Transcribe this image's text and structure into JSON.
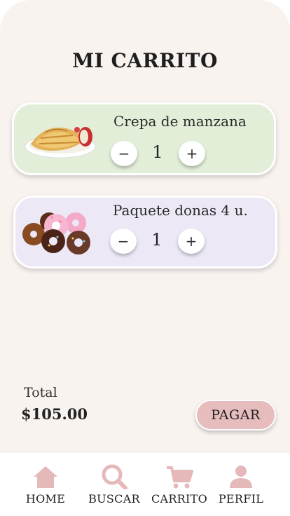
{
  "header": {
    "title": "MI CARRITO"
  },
  "cart": {
    "items": [
      {
        "name": "Crepa de manzana",
        "quantity": "1",
        "image_icon": "crepe-image",
        "card_color": "#e2eed8"
      },
      {
        "name": "Paquete donas 4 u.",
        "quantity": "1",
        "image_icon": "donuts-image",
        "card_color": "#ece8f6"
      }
    ],
    "minus_symbol": "−",
    "plus_symbol": "+"
  },
  "summary": {
    "total_label": "Total",
    "total_amount": "$105.00",
    "pay_label": "PAGAR"
  },
  "nav": {
    "items": [
      {
        "label": "HOME",
        "icon": "home-icon"
      },
      {
        "label": "BUSCAR",
        "icon": "search-icon"
      },
      {
        "label": "CARRITO",
        "icon": "cart-icon"
      },
      {
        "label": "PERFIL",
        "icon": "user-icon"
      }
    ]
  },
  "colors": {
    "background": "#f9f3f0",
    "accent": "#e6bcbc",
    "nav_icon": "#e5b9b9"
  }
}
